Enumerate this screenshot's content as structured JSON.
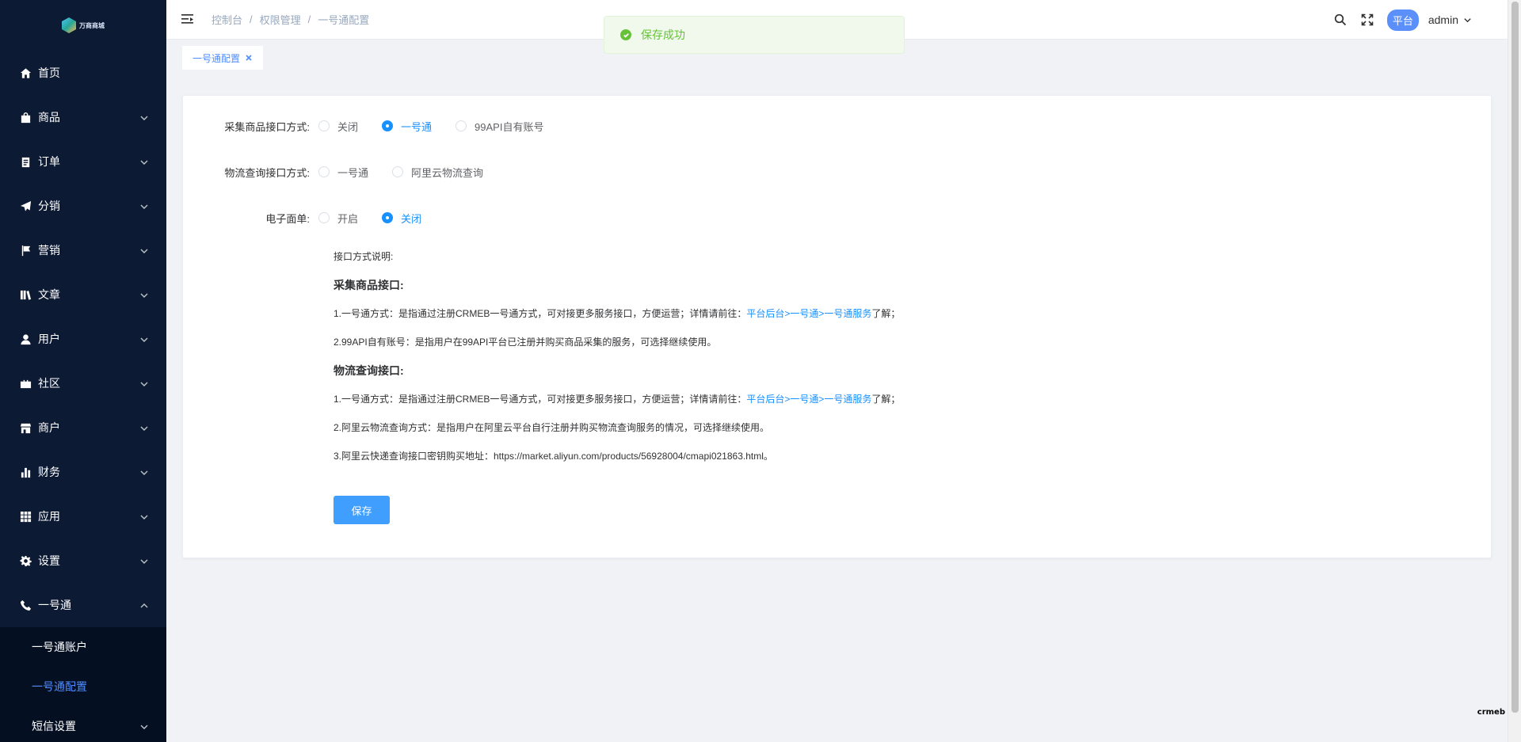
{
  "logo": {
    "text": "万商商城"
  },
  "sidebar": {
    "items": [
      {
        "label": "首页",
        "icon": "home-icon",
        "arrow": false
      },
      {
        "label": "商品",
        "icon": "shopping-bag-icon",
        "arrow": true
      },
      {
        "label": "订单",
        "icon": "clipboard-icon",
        "arrow": true
      },
      {
        "label": "分销",
        "icon": "paper-plane-icon",
        "arrow": true
      },
      {
        "label": "营销",
        "icon": "flag-icon",
        "arrow": true
      },
      {
        "label": "文章",
        "icon": "books-icon",
        "arrow": true
      },
      {
        "label": "用户",
        "icon": "user-icon",
        "arrow": true
      },
      {
        "label": "社区",
        "icon": "briefcase-icon",
        "arrow": true
      },
      {
        "label": "商户",
        "icon": "store-icon",
        "arrow": true
      },
      {
        "label": "财务",
        "icon": "bar-chart-icon",
        "arrow": true
      },
      {
        "label": "应用",
        "icon": "grid-icon",
        "arrow": true
      },
      {
        "label": "设置",
        "icon": "gear-icon",
        "arrow": true
      },
      {
        "label": "一号通",
        "icon": "phone-icon",
        "arrow": true,
        "expanded": true
      }
    ],
    "submenu": [
      {
        "label": "一号通账户",
        "active": false
      },
      {
        "label": "一号通配置",
        "active": true
      },
      {
        "label": "短信设置",
        "active": false
      }
    ]
  },
  "header": {
    "breadcrumb": [
      "控制台",
      "权限管理",
      "一号通配置"
    ],
    "role_badge": "平台",
    "username": "admin"
  },
  "tags": {
    "active_tag": "一号通配置"
  },
  "toast": {
    "message": "保存成功"
  },
  "form": {
    "collect": {
      "label": "采集商品接口方式:",
      "options": [
        "关闭",
        "一号通",
        "99API自有账号"
      ],
      "selected": 1
    },
    "logistics": {
      "label": "物流查询接口方式:",
      "options": [
        "一号通",
        "阿里云物流查询"
      ],
      "selected": -1
    },
    "esheet": {
      "label": "电子面单:",
      "options": [
        "开启",
        "关闭"
      ],
      "selected": 1
    }
  },
  "description": {
    "heading": "接口方式说明:",
    "collect_title": "采集商品接口:",
    "collect_line1_prefix": "1.一号通方式：是指通过注册CRMEB一号通方式，可对接更多服务接口，方便运营；详情请前往：",
    "collect_line1_link": "平台后台>一号通>一号通服务",
    "collect_line1_suffix": "了解；",
    "collect_line2": "2.99API自有账号：是指用户在99API平台已注册并购买商品采集的服务，可选择继续使用。",
    "logistics_title": "物流查询接口:",
    "logistics_line1_prefix": "1.一号通方式：是指通过注册CRMEB一号通方式，可对接更多服务接口，方便运营；详情请前往：",
    "logistics_line1_link": "平台后台>一号通>一号通服务",
    "logistics_line1_suffix": "了解；",
    "logistics_line2": "2.阿里云物流查询方式：是指用户在阿里云平台自行注册并购买物流查询服务的情况，可选择继续使用。",
    "logistics_line3": "3.阿里云快递查询接口密钥购买地址：https://market.aliyun.com/products/56928004/cmapi021863.html。"
  },
  "save_button": {
    "label": "保存"
  },
  "brand_mark": "crmeb"
}
